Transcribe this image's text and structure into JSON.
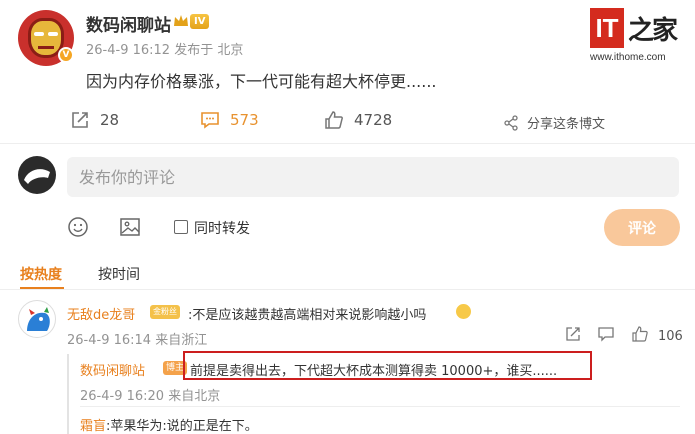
{
  "post": {
    "author": "数码闲聊站",
    "level_badge": "IV",
    "verify_badge": "V",
    "meta": "26-4-9 16:12 发布于 北京",
    "text": "因为内存价格暴涨，下一代可能有超大杯停更......"
  },
  "logo": {
    "it": "IT",
    "zhi": "之家",
    "url": "www.ithome.com"
  },
  "actions": {
    "reposts": "28",
    "comments": "573",
    "likes": "4728",
    "share": "分享这条博文"
  },
  "composer": {
    "placeholder": "发布你的评论",
    "forward_label": "同时转发",
    "submit_label": "评论"
  },
  "tabs": {
    "hot": "按热度",
    "time": "按时间"
  },
  "comment": {
    "author": "无敌de龙哥",
    "gold_badge": "金粉丝",
    "text": ":不是应该越贵越高端相对来说影响越小吗",
    "meta": "26-4-9 16:14 来自浙江",
    "likes": "106"
  },
  "reply": {
    "author": "数码闲聊站",
    "badge": "博主",
    "text": "前提是卖得出去，下代超大杯成本测算得卖 10000+，谁买......",
    "meta": "26-4-9 16:20 来自北京",
    "sub_author": "霜盲",
    "sub_text": ":苹果华为:说的正是在下。"
  },
  "colors": {
    "accent": "#e8801e",
    "highlight_border": "#cc1e1e",
    "logo_red": "#d42b1e"
  }
}
